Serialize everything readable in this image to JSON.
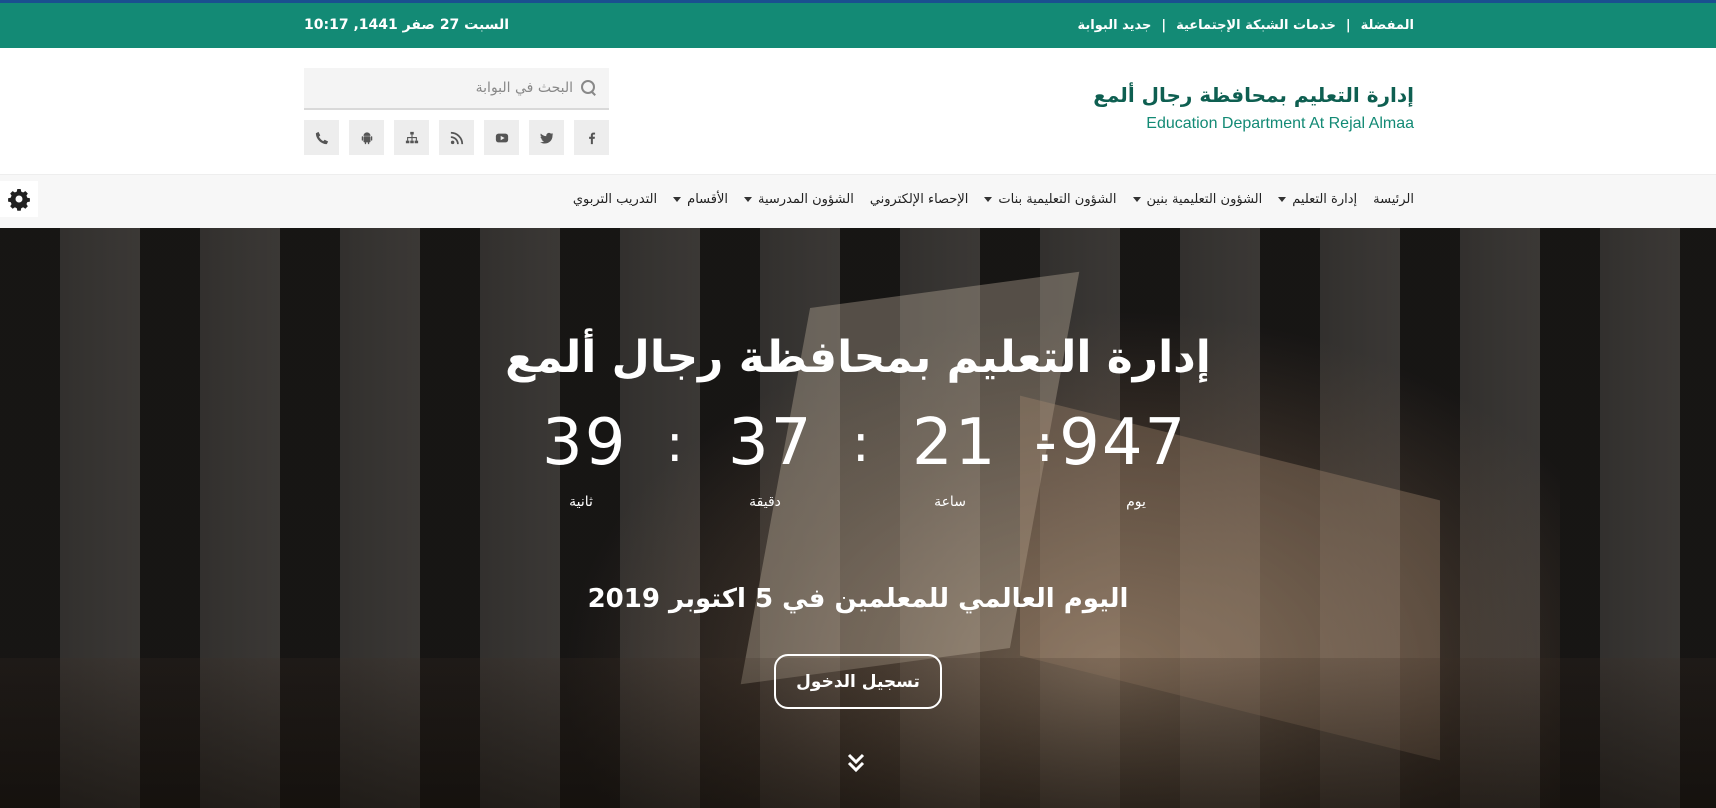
{
  "topbar": {
    "links": [
      "المفضلة",
      "خدمات الشبكة الإجتماعية",
      "جديد البوابة"
    ],
    "separator": "|",
    "datetime": "السبت 27 صفر 1441, 10:17"
  },
  "brand": {
    "title_ar": "إدارة التعليم بمحافظة رجال ألمع",
    "title_en": "Education Department At Rejal Almaa"
  },
  "search": {
    "placeholder": "البحث في البوابة"
  },
  "socials": [
    "facebook-icon",
    "twitter-icon",
    "youtube-icon",
    "rss-icon",
    "sitemap-icon",
    "android-icon",
    "phone-icon"
  ],
  "nav": {
    "items": [
      {
        "label": "الرئيسة",
        "dropdown": false
      },
      {
        "label": "إدارة التعليم",
        "dropdown": true
      },
      {
        "label": "الشؤون التعليمية بنين",
        "dropdown": true
      },
      {
        "label": "الشؤون التعليمية بنات",
        "dropdown": true
      },
      {
        "label": "الإحصاء الإلكتروني",
        "dropdown": false
      },
      {
        "label": "الشؤون المدرسية",
        "dropdown": true
      },
      {
        "label": "الأقسام",
        "dropdown": true
      },
      {
        "label": "التدريب التربوي",
        "dropdown": false
      }
    ]
  },
  "hero": {
    "title": "إدارة التعليم بمحافظة رجال ألمع",
    "countdown": {
      "days": "-947",
      "hours": "21",
      "minutes": "37",
      "seconds": "39",
      "days_label": "يوم",
      "hours_label": "ساعة",
      "minutes_label": "دقيقة",
      "seconds_label": "ثانية",
      "separator": ":"
    },
    "occasion": "اليوم العالمي للمعلمين في 5 اكتوبر 2019",
    "login_label": "تسجيل الدخول"
  },
  "colors": {
    "brand_green": "#138a75",
    "brand_dark": "#0e5f51",
    "accent_line": "#1a4f8f"
  }
}
